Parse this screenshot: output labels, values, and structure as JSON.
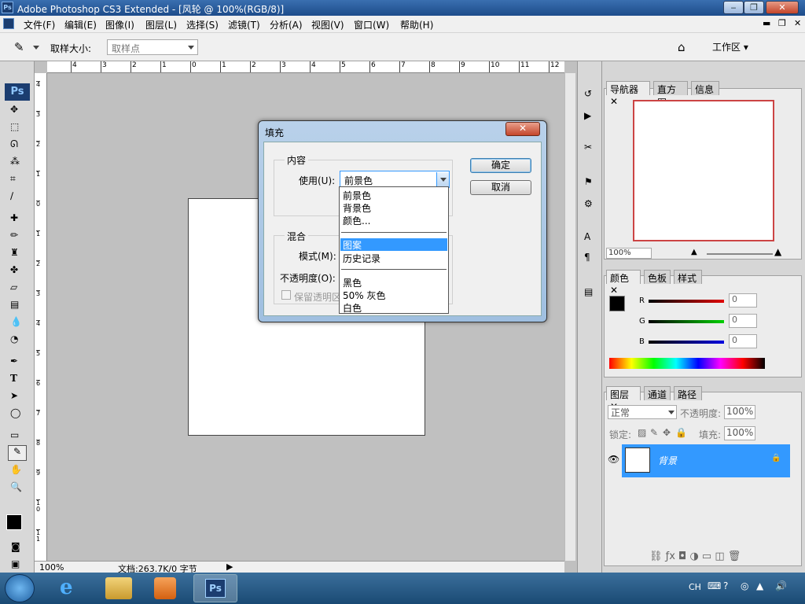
{
  "window": {
    "title": "Adobe Photoshop CS3 Extended - [风轮 @ 100%(RGB/8)]",
    "app_icon": "Ps"
  },
  "menu": [
    "文件(F)",
    "编辑(E)",
    "图像(I)",
    "图层(L)",
    "选择(S)",
    "滤镜(T)",
    "分析(A)",
    "视图(V)",
    "窗口(W)",
    "帮助(H)"
  ],
  "options": {
    "sample_size_label": "取样大小:",
    "sample_size_value": "取样点",
    "workspace_label": "工作区 ▾"
  },
  "ruler_top": [
    "4",
    "3",
    "2",
    "1",
    "0",
    "1",
    "2",
    "3",
    "4",
    "5",
    "6",
    "7",
    "8",
    "9",
    "10",
    "11",
    "12"
  ],
  "ruler_left": [
    "4",
    "3",
    "2",
    "1",
    "0",
    "1",
    "2",
    "3",
    "4",
    "5",
    "6",
    "7",
    "8",
    "9",
    "1\n0",
    "1\n1"
  ],
  "status": {
    "zoom": "100%",
    "doc": "文档:263.7K/0 字节"
  },
  "dialog": {
    "title": "填充",
    "content_group": "内容",
    "use_label": "使用(U):",
    "use_value": "前景色",
    "blend_group": "混合",
    "mode_label": "模式(M):",
    "opacity_label": "不透明度(O):",
    "preserve_label": "保留透明区",
    "ok": "确定",
    "cancel": "取消",
    "options": [
      "前景色",
      "背景色",
      "颜色...",
      "图案",
      "历史记录",
      "黑色",
      "50% 灰色",
      "白色"
    ],
    "selected_option": "图案"
  },
  "navigator": {
    "tabs": [
      "导航器",
      "直方图",
      "信息"
    ],
    "zoom": "100%"
  },
  "color_panel": {
    "tabs": [
      "颜色",
      "色板",
      "样式"
    ],
    "channels": [
      {
        "name": "R",
        "value": "0"
      },
      {
        "name": "G",
        "value": "0"
      },
      {
        "name": "B",
        "value": "0"
      }
    ]
  },
  "layers_panel": {
    "tabs": [
      "图层",
      "通道",
      "路径"
    ],
    "blend_mode": "正常",
    "opacity_label": "不透明度:",
    "opacity_value": "100%",
    "lock_label": "锁定:",
    "fill_label": "填充:",
    "fill_value": "100%",
    "layer_name": "背景"
  },
  "taskbar": {
    "lang": "CH",
    "active_app": "Ps"
  },
  "colors": {
    "accent": "#3399ff",
    "title": "#1d4c8a",
    "selection": "#3399ff"
  }
}
